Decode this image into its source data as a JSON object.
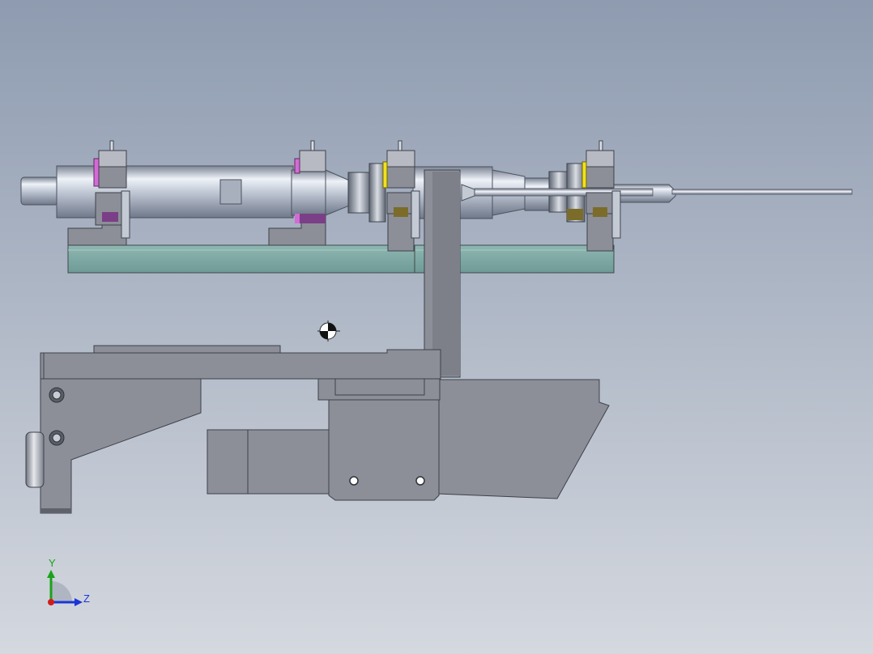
{
  "viewport": {
    "background_top": "#8e9bb0",
    "background_bottom": "#d4d8df"
  },
  "colors": {
    "shaft_light": "#eef2f8",
    "shaft_mid": "#b9c1cf",
    "shaft_dark": "#6f7889",
    "block_gray": "#8c8f98",
    "block_dark": "#6d7079",
    "rail_teal": "#7fa8a4",
    "magenta": "#d36bd6",
    "yellow": "#f2e21a",
    "purple": "#7a3f86",
    "olive": "#7b6c2a"
  },
  "triad": {
    "y_label": "Y",
    "z_label": "Z",
    "y_color": "#1aa21a",
    "z_color": "#1b35d6",
    "x_color": "#d41b1b"
  },
  "icons": {
    "center_of_mass": "center-of-mass-icon"
  }
}
